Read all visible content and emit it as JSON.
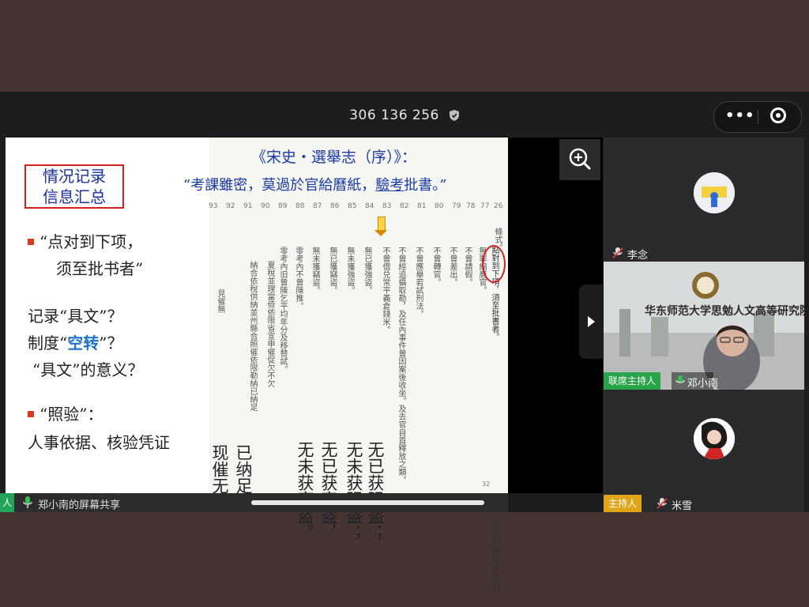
{
  "meeting": {
    "id": "306 136 256"
  },
  "slide": {
    "box_title_lines": [
      "情况记录",
      "信息汇总"
    ],
    "left": {
      "bullet1_line1": "“点对到下项，",
      "bullet1_line2": "须至批书者”",
      "q1": "记录“具文”？",
      "q2_pre": "制度“",
      "q2_blue": "空转",
      "q2_post": "”？",
      "q3": "“具文”的意义？",
      "bullet2": "“照验”：",
      "bullet2_detail": "人事依据、核验凭证"
    },
    "quote_title": "《宋史・選舉志（序）》：",
    "quote_line_pre": "“考課雖密，莫過於官給曆紙，",
    "quote_line_u": "驗考",
    "quote_line_post": "批書。”",
    "col_numbers": [
      "93",
      "92",
      "91",
      "90",
      "89",
      "88",
      "87",
      "86",
      "85",
      "84",
      "83",
      "82",
      "81",
      "80",
      "79",
      "78",
      "77",
      "26"
    ],
    "scan_columns": [
      "條式。",
      "點對到下項，須至批書者。",
      "無罪縮曆官。",
      "不曾請假。",
      "不曾差出。",
      "不曾轉官。",
      "不曾應舉若試刑法。",
      "不曾經追攝取勘，及任內事件曾因案後收坐。及去官自首釋放之類。",
      "不曾借兑常平義倉錢米。",
      "無已獲強盜。",
      "無未獲強盜。",
      "無已獲竊盜。",
      "無未獲竊盜。",
      "零考內不曾陳推。",
      "零考內旧曾陳乞平均年分及移替試。",
      "夏稅並理當倚依限省宣申催促欠不欠",
      "納合依稅供納並州縣合照催依限勒納已納足",
      "見催無"
    ],
    "handwriting": [
      "无已获强盗；",
      "无未获强盗；",
      "无已获窃盗，",
      "无未获窃盗。",
      "已纳足",
      "现催无"
    ],
    "vertical_note": "知濮阳县零考批书",
    "page_number": "32"
  },
  "status": {
    "share_text": "郑小南的屏幕共享",
    "left_fragment": "人"
  },
  "participants": [
    {
      "name": "李念",
      "tag": ""
    },
    {
      "name": "邓小南",
      "tag": "联席主持人",
      "video_caption": "华东师范大学思勉人文高等研究院"
    },
    {
      "name": "米雪",
      "tag": "主持人"
    }
  ],
  "colors": {
    "accent_green": "#2aa44a",
    "accent_yellow": "#e0a51a",
    "frame_red": "#d42020",
    "quote_blue": "#1a3aa5"
  }
}
